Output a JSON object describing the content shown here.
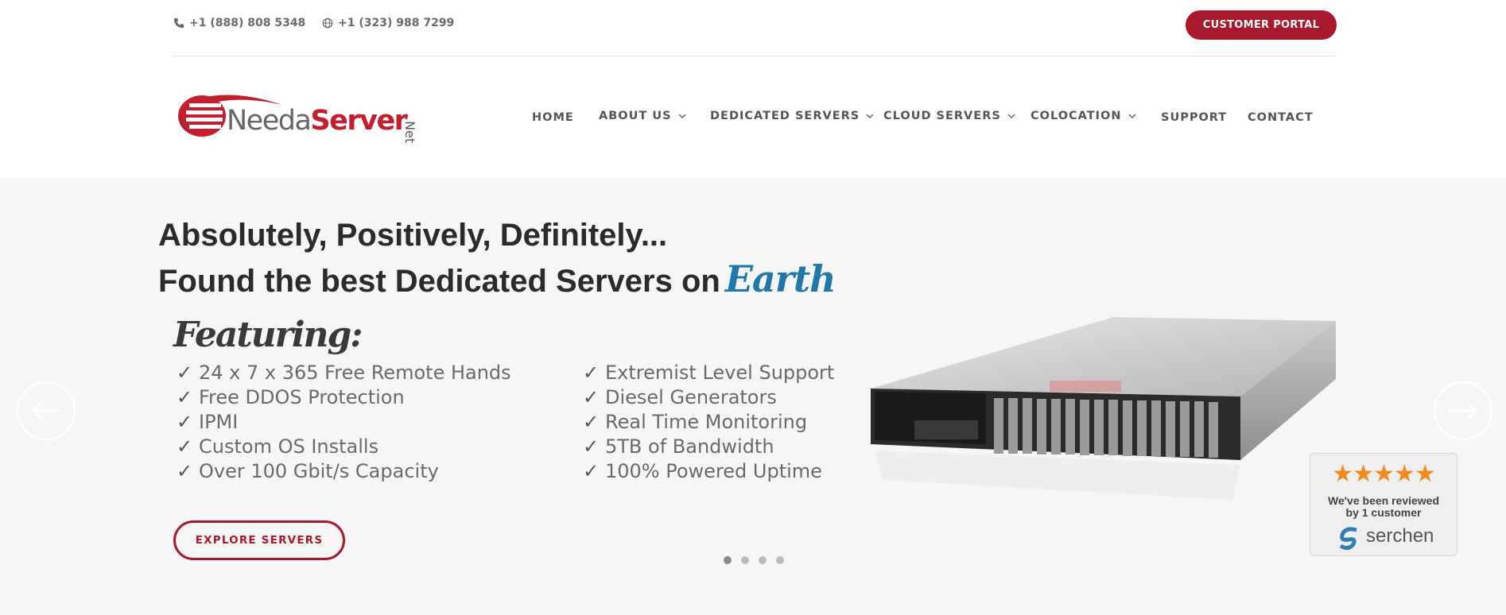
{
  "topbar": {
    "phone_primary": "+1 (888) 808 5348",
    "phone_secondary": "+1 (323) 988 7299",
    "portal_label": "CUSTOMER PORTAL"
  },
  "logo": {
    "name_part1": "Needa",
    "name_part2": "Server",
    "suffix": ".Net"
  },
  "nav": {
    "items": [
      {
        "label": "HOME",
        "has_dropdown": false
      },
      {
        "label": "ABOUT US",
        "has_dropdown": true
      },
      {
        "label": "DEDICATED SERVERS",
        "has_dropdown": true
      },
      {
        "label": "CLOUD SERVERS",
        "has_dropdown": true
      },
      {
        "label": "COLOCATION",
        "has_dropdown": true
      },
      {
        "label": "SUPPORT",
        "has_dropdown": false
      },
      {
        "label": "CONTACT",
        "has_dropdown": false
      }
    ]
  },
  "hero": {
    "headline_line1": "Absolutely, Positively, Definitely...",
    "headline_line2": "Found the best Dedicated Servers on",
    "headline_accent": "Earth",
    "featuring": "Featuring:",
    "features_left": [
      "24 x 7 x 365 Free Remote Hands",
      "Free DDOS Protection",
      "IPMI",
      "Custom OS Installs",
      "Over 100 Gbit/s Capacity"
    ],
    "features_right": [
      "Extremist Level Support",
      "Diesel Generators",
      "Real Time Monitoring",
      "5TB of Bandwidth",
      "100% Powered Uptime"
    ],
    "check_glyph": "✓",
    "cta_label": "EXPLORE SERVERS",
    "slide_count": 4,
    "active_slide": 1
  },
  "review_badge": {
    "stars": "★★★★★",
    "line1": "We've been reviewed",
    "line2": "by 1 customer",
    "brand": "serchen"
  },
  "colors": {
    "brand_red": "#a8192c",
    "accent_blue": "#1f78a8",
    "hero_bg": "#f6f6f6",
    "star_orange": "#f08a1c"
  }
}
